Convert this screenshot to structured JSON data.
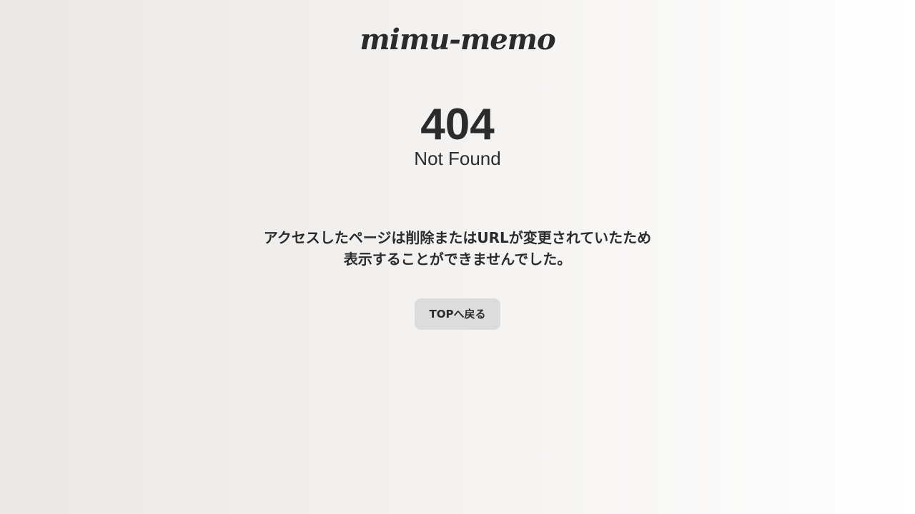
{
  "header": {
    "logo_text": "mimu-memo"
  },
  "error": {
    "code": "404",
    "status": "Not Found",
    "message_line1": "アクセスしたページは削除またはURLが変更されていたため",
    "message_line2": "表示することができませんでした。"
  },
  "actions": {
    "top_label": "TOPへ戻る"
  },
  "colors": {
    "text": "#2b2b2b",
    "button_bg": "#dcdcdc"
  }
}
